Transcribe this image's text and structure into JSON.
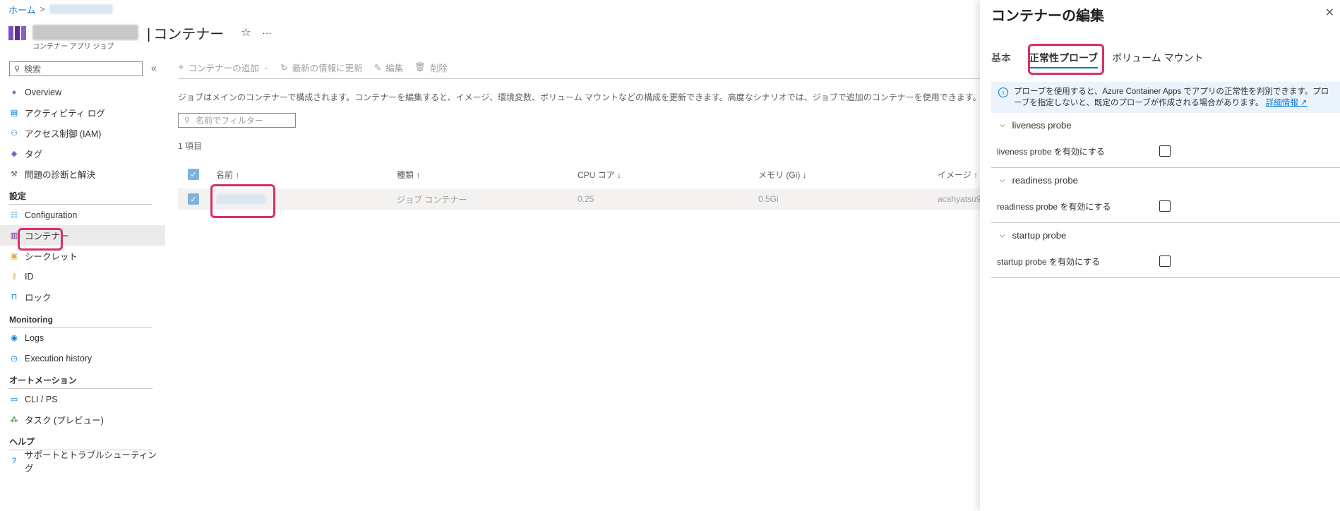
{
  "breadcrumb": {
    "home": "ホーム",
    "separator": ">"
  },
  "header": {
    "title": "コンテナー",
    "separator": "|",
    "subtitle": "コンテナー アプリ ジョブ",
    "favorite_icon": "☆",
    "more_icon": "···"
  },
  "nav": {
    "search_placeholder": "検索",
    "collapse_icon": "«",
    "items": [
      {
        "type": "item",
        "label": "Overview",
        "icon": "overview-icon"
      },
      {
        "type": "item",
        "label": "アクティビティ ログ",
        "icon": "activity-log-icon"
      },
      {
        "type": "item",
        "label": "アクセス制御 (IAM)",
        "icon": "iam-icon"
      },
      {
        "type": "item",
        "label": "タグ",
        "icon": "tag-icon"
      },
      {
        "type": "item",
        "label": "問題の診断と解決",
        "icon": "wrench-icon"
      },
      {
        "type": "section",
        "label": "設定"
      },
      {
        "type": "item",
        "label": "Configuration",
        "icon": "configuration-icon"
      },
      {
        "type": "item",
        "label": "コンテナー",
        "icon": "container-icon",
        "active": true
      },
      {
        "type": "item",
        "label": "シークレット",
        "icon": "secret-icon"
      },
      {
        "type": "item",
        "label": "ID",
        "icon": "identity-icon"
      },
      {
        "type": "item",
        "label": "ロック",
        "icon": "lock-icon"
      },
      {
        "type": "section",
        "label": "Monitoring"
      },
      {
        "type": "item",
        "label": "Logs",
        "icon": "logs-icon"
      },
      {
        "type": "item",
        "label": "Execution history",
        "icon": "history-icon"
      },
      {
        "type": "section",
        "label": "オートメーション"
      },
      {
        "type": "item",
        "label": "CLI / PS",
        "icon": "cli-icon"
      },
      {
        "type": "item",
        "label": "タスク (プレビュー)",
        "icon": "tasks-icon"
      },
      {
        "type": "section",
        "label": "ヘルプ"
      },
      {
        "type": "item",
        "label": "サポートとトラブルシューティング",
        "icon": "help-icon"
      }
    ]
  },
  "toolbar": {
    "add": "コンテナーの追加",
    "refresh": "最新の情報に更新",
    "edit": "編集",
    "delete": "削除"
  },
  "main": {
    "description": "ジョブはメインのコンテナーで構成されます。コンテナーを編集すると、イメージ、環境変数、ボリューム マウントなどの構成を更新できます。高度なシナリオでは、ジョブで追加のコンテナーを使用できます。",
    "filter_placeholder": "名前でフィルター",
    "count": "1 項目",
    "columns": [
      "名前 ↑",
      "種類 ↑",
      "CPU コア ↓",
      "メモリ (Gi) ↓",
      "イメージ ↑"
    ],
    "rows": [
      {
        "name": "",
        "type": "ジョブ コンテナー",
        "cpu": "0.25",
        "memory": "0.5Gi",
        "image": "acahyatsu92"
      }
    ]
  },
  "panel": {
    "title": "コンテナーの編集",
    "close_icon": "✕",
    "tabs": [
      "基本",
      "正常性プローブ",
      "ボリューム マウント"
    ],
    "active_tab": 1,
    "info": "プローブを使用すると、Azure Container Apps でアプリの正常性を判別できます。プローブを指定しないと、既定のプローブが作成される場合があります。",
    "info_link": "詳細情報",
    "probes": [
      {
        "title": "liveness probe",
        "label": "liveness probe を有効にする",
        "enabled": false
      },
      {
        "title": "readiness probe",
        "label": "readiness probe を有効にする",
        "enabled": false
      },
      {
        "title": "startup probe",
        "label": "startup probe を有効にする",
        "enabled": false
      }
    ]
  },
  "colors": {
    "accent": "#0078d4",
    "highlight": "#d6306c",
    "container_purple": "#5c2d91"
  }
}
